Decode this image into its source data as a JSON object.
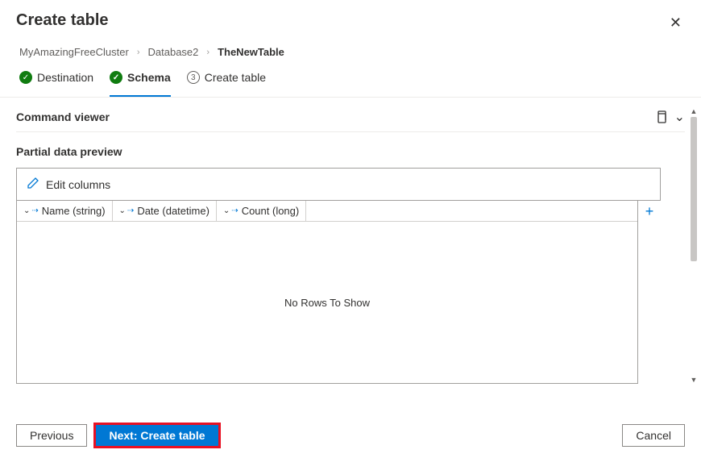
{
  "header": {
    "title": "Create table"
  },
  "breadcrumb": {
    "cluster": "MyAmazingFreeCluster",
    "database": "Database2",
    "table": "TheNewTable"
  },
  "stepper": {
    "step1_label": "Destination",
    "step2_label": "Schema",
    "step3_label": "Create table",
    "step3_num": "3"
  },
  "command_viewer": {
    "title": "Command viewer"
  },
  "preview": {
    "title": "Partial data preview",
    "edit_columns_label": "Edit columns",
    "columns": [
      {
        "label": "Name (string)"
      },
      {
        "label": "Date (datetime)"
      },
      {
        "label": "Count (long)"
      }
    ],
    "empty_text": "No Rows To Show"
  },
  "footer": {
    "previous_label": "Previous",
    "next_label": "Next: Create table",
    "cancel_label": "Cancel"
  }
}
